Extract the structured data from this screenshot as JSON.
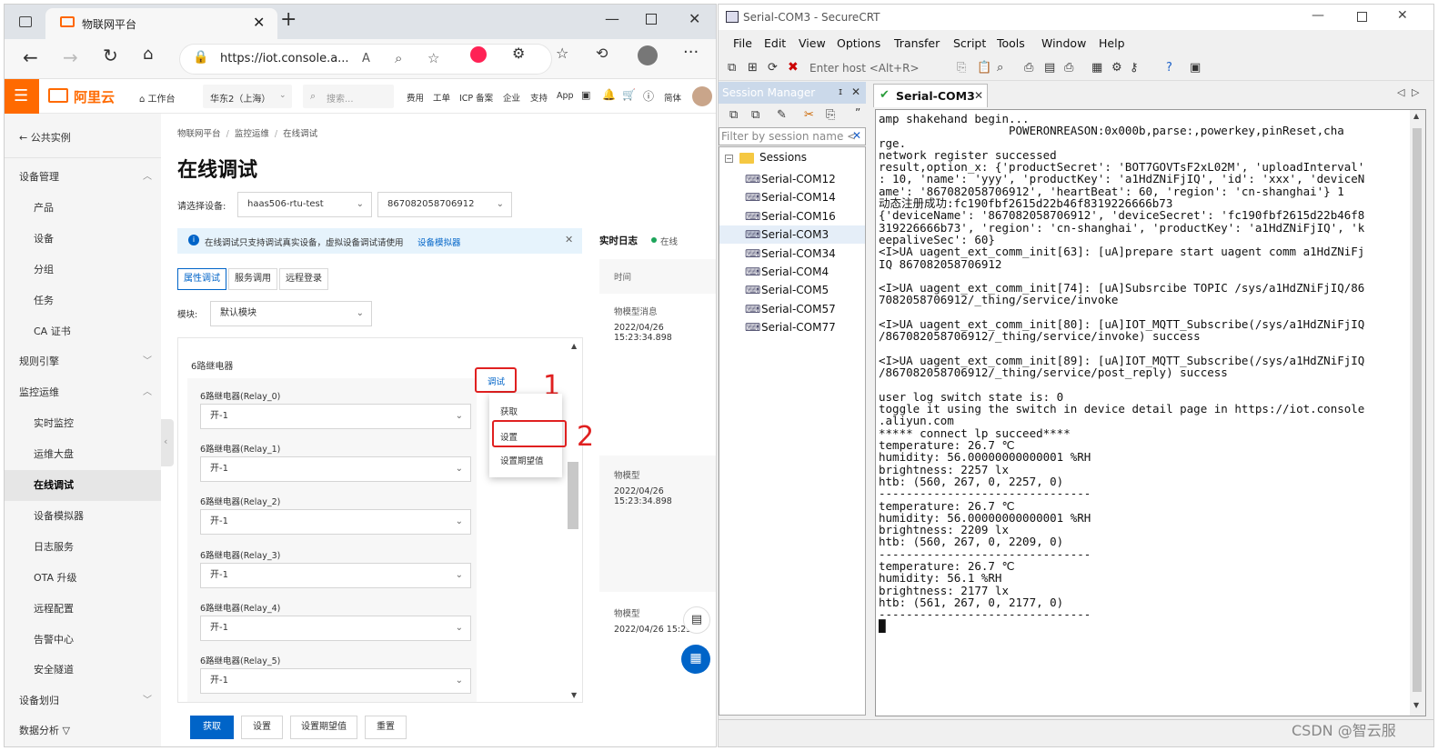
{
  "browser": {
    "tab_title": "物联网平台",
    "url": "https://iot.console.a...",
    "brand": "阿里云",
    "topnav": {
      "workbench": "工作台",
      "region": "华东2（上海）",
      "search_placeholder": "搜索...",
      "links": [
        "费用",
        "工单",
        "ICP 备案",
        "企业",
        "支持",
        "App"
      ],
      "lang": "简体"
    },
    "sidebar": {
      "back": "公共实例",
      "items": [
        {
          "label": "设备管理",
          "type": "group",
          "chev": "^"
        },
        {
          "label": "产品",
          "type": "sub"
        },
        {
          "label": "设备",
          "type": "sub"
        },
        {
          "label": "分组",
          "type": "sub"
        },
        {
          "label": "任务",
          "type": "sub"
        },
        {
          "label": "CA 证书",
          "type": "sub"
        },
        {
          "label": "规则引擎",
          "type": "group",
          "chev": "v"
        },
        {
          "label": "监控运维",
          "type": "group",
          "chev": "^"
        },
        {
          "label": "实时监控",
          "type": "sub"
        },
        {
          "label": "运维大盘",
          "type": "sub"
        },
        {
          "label": "在线调试",
          "type": "sub",
          "active": true
        },
        {
          "label": "设备模拟器",
          "type": "sub"
        },
        {
          "label": "日志服务",
          "type": "sub"
        },
        {
          "label": "OTA 升级",
          "type": "sub"
        },
        {
          "label": "远程配置",
          "type": "sub"
        },
        {
          "label": "告警中心",
          "type": "sub"
        },
        {
          "label": "安全隧道",
          "type": "sub"
        },
        {
          "label": "设备划归",
          "type": "group",
          "chev": "v"
        }
      ],
      "cut_item": "数据分析 ▽"
    },
    "main": {
      "breadcrumb": [
        "物联网平台",
        "监控运维",
        "在线调试"
      ],
      "title": "在线调试",
      "device_label": "请选择设备:",
      "product": "haas506-rtu-test",
      "device": "867082058706912",
      "notice": "在线调试只支持调试真实设备，虚拟设备调试请使用",
      "notice_link": "设备模拟器",
      "tabs": [
        "属性调试",
        "服务调用",
        "远程登录"
      ],
      "module_label": "模块:",
      "module_value": "默认模块",
      "group_title": "6路继电器",
      "debug_link": "调试",
      "relays": [
        {
          "label": "6路继电器(Relay_0)",
          "value": "开-1"
        },
        {
          "label": "6路继电器(Relay_1)",
          "value": "开-1"
        },
        {
          "label": "6路继电器(Relay_2)",
          "value": "开-1"
        },
        {
          "label": "6路继电器(Relay_3)",
          "value": "开-1"
        },
        {
          "label": "6路继电器(Relay_4)",
          "value": "开-1"
        },
        {
          "label": "6路继电器(Relay_5)",
          "value": "开-1"
        }
      ],
      "popup": [
        "获取",
        "设置",
        "设置期望值"
      ],
      "annotations": [
        "1",
        "2"
      ],
      "buttons": [
        "获取",
        "设置",
        "设置期望值",
        "重置"
      ]
    },
    "log": {
      "title": "实时日志",
      "status": "在线",
      "col_time": "时间",
      "entries": [
        {
          "type": "物模型消息",
          "time": "2022/04/26 15:23:34.898"
        },
        {
          "type": "物模型",
          "time": "2022/04/26 15:23:34.898"
        },
        {
          "type": "物模型",
          "time": "2022/04/26 15:23..."
        }
      ]
    }
  },
  "crt": {
    "title": "Serial-COM3 - SecureCRT",
    "menu": [
      "File",
      "Edit",
      "View",
      "Options",
      "Transfer",
      "Script",
      "Tools",
      "Window",
      "Help"
    ],
    "enter_host": "Enter host <Alt+R>",
    "session_manager": "Session Manager",
    "filter_placeholder": "Filter by session name <",
    "sessions_root": "Sessions",
    "sessions": [
      "Serial-COM12",
      "Serial-COM14",
      "Serial-COM16",
      "Serial-COM3",
      "Serial-COM34",
      "Serial-COM4",
      "Serial-COM5",
      "Serial-COM57",
      "Serial-COM77"
    ],
    "active_tab": "Serial-COM3",
    "terminal": [
      "amp shakehand begin...",
      "                   POWERONREASON:0x000b,parse:,powerkey,pinReset,cha",
      "rge.",
      "network register successed",
      "result,option_x: {'productSecret': 'BOT7GOVTsF2xL02M', 'uploadInterval'",
      ": 10, 'name': 'yyy', 'productKey': 'a1HdZNiFjIQ', 'id': 'xxx', 'deviceN",
      "ame': '867082058706912', 'heartBeat': 60, 'region': 'cn-shanghai'} 1",
      "动态注册成功:fc190fbf2615d22b46f8319226666b73",
      "{'deviceName': '867082058706912', 'deviceSecret': 'fc190fbf2615d22b46f8",
      "319226666b73', 'region': 'cn-shanghai', 'productKey': 'a1HdZNiFjIQ', 'k",
      "eepaliveSec': 60}",
      "<I>UA uagent_ext_comm_init[63]: [uA]prepare start uagent comm a1HdZNiFj",
      "IQ 867082058706912",
      "",
      "<I>UA uagent_ext_comm_init[74]: [uA]Subsrcibe TOPIC /sys/a1HdZNiFjIQ/86",
      "7082058706912/_thing/service/invoke",
      "",
      "<I>UA uagent_ext_comm_init[80]: [uA]IOT_MQTT_Subscribe(/sys/a1HdZNiFjIQ",
      "/867082058706912/_thing/service/invoke) success",
      "",
      "<I>UA uagent_ext_comm_init[89]: [uA]IOT_MQTT_Subscribe(/sys/a1HdZNiFjIQ",
      "/867082058706912/_thing/service/post_reply) success",
      "",
      "user log switch state is: 0",
      "toggle it using the switch in device detail page in https://iot.console",
      ".aliyun.com",
      "***** connect lp succeed****",
      "temperature: 26.7 ℃",
      "humidity: 56.00000000000001 %RH",
      "brightness: 2257 lx",
      "htb: (560, 267, 0, 2257, 0)",
      "-------------------------------",
      "temperature: 26.7 ℃",
      "humidity: 56.00000000000001 %RH",
      "brightness: 2209 lx",
      "htb: (560, 267, 0, 2209, 0)",
      "-------------------------------",
      "temperature: 26.7 ℃",
      "humidity: 56.1 %RH",
      "brightness: 2177 lx",
      "htb: (561, 267, 0, 2177, 0)",
      "-------------------------------",
      "█"
    ]
  },
  "watermark": "CSDN @智云服"
}
